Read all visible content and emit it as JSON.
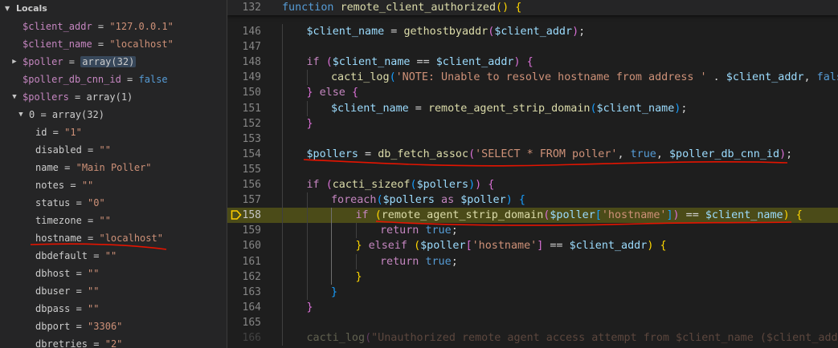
{
  "locals": {
    "header": "Locals",
    "rows": [
      {
        "name": "$client_addr",
        "value": "\"127.0.0.1\"",
        "vtype": "str"
      },
      {
        "name": "$client_name",
        "value": "\"localhost\"",
        "vtype": "str"
      },
      {
        "name": "$poller",
        "value": "array(32)",
        "vtype": "hl"
      },
      {
        "name": "$poller_db_cnn_id",
        "value": "false",
        "vtype": "bool"
      },
      {
        "name": "$pollers",
        "value": "array(1)",
        "vtype": "plain"
      },
      {
        "name": "0",
        "value": "array(32)",
        "vtype": "plain"
      },
      {
        "name": "id",
        "value": "\"1\"",
        "vtype": "str"
      },
      {
        "name": "disabled",
        "value": "\"\"",
        "vtype": "str"
      },
      {
        "name": "name",
        "value": "\"Main Poller\"",
        "vtype": "str"
      },
      {
        "name": "notes",
        "value": "\"\"",
        "vtype": "str"
      },
      {
        "name": "status",
        "value": "\"0\"",
        "vtype": "str"
      },
      {
        "name": "timezone",
        "value": "\"\"",
        "vtype": "str"
      },
      {
        "name": "hostname",
        "value": "\"localhost\"",
        "vtype": "str"
      },
      {
        "name": "dbdefault",
        "value": "\"\"",
        "vtype": "str"
      },
      {
        "name": "dbhost",
        "value": "\"\"",
        "vtype": "str"
      },
      {
        "name": "dbuser",
        "value": "\"\"",
        "vtype": "str"
      },
      {
        "name": "dbpass",
        "value": "\"\"",
        "vtype": "str"
      },
      {
        "name": "dbport",
        "value": "\"3306\"",
        "vtype": "str"
      },
      {
        "name": "dbretries",
        "value": "\"2\"",
        "vtype": "str"
      }
    ]
  },
  "editor": {
    "sticky_line": {
      "num": "132",
      "tokens": [
        [
          "kwb",
          "function "
        ],
        [
          "fn",
          "remote_client_authorized"
        ],
        [
          "brk1",
          "()"
        ],
        [
          "pun",
          " "
        ],
        [
          "brk1",
          "{"
        ]
      ]
    },
    "lines": [
      {
        "num": "146",
        "tokens": [
          [
            "var",
            "$client_name"
          ],
          [
            "pun",
            " = "
          ],
          [
            "fn",
            "gethostbyaddr"
          ],
          [
            "brk2",
            "("
          ],
          [
            "var",
            "$client_addr"
          ],
          [
            "brk2",
            ")"
          ],
          [
            "pun",
            ";"
          ]
        ]
      },
      {
        "num": "147",
        "tokens": []
      },
      {
        "num": "148",
        "tokens": [
          [
            "kw",
            "if "
          ],
          [
            "brk2",
            "("
          ],
          [
            "var",
            "$client_name"
          ],
          [
            "pun",
            " == "
          ],
          [
            "var",
            "$client_addr"
          ],
          [
            "brk2",
            ")"
          ],
          [
            "pun",
            " "
          ],
          [
            "brk2",
            "{"
          ]
        ]
      },
      {
        "num": "149",
        "tokens": [
          [
            "fn",
            "cacti_log"
          ],
          [
            "brk3",
            "("
          ],
          [
            "str",
            "'NOTE: Unable to resolve hostname from address '"
          ],
          [
            "pun",
            " . "
          ],
          [
            "var",
            "$client_addr"
          ],
          [
            "pun",
            ", "
          ],
          [
            "kwb",
            "false"
          ],
          [
            "pun",
            ","
          ]
        ]
      },
      {
        "num": "150",
        "tokens": [
          [
            "brk2",
            "}"
          ],
          [
            "pun",
            " "
          ],
          [
            "kw",
            "else"
          ],
          [
            "pun",
            " "
          ],
          [
            "brk2",
            "{"
          ]
        ]
      },
      {
        "num": "151",
        "tokens": [
          [
            "var",
            "$client_name"
          ],
          [
            "pun",
            " = "
          ],
          [
            "fn",
            "remote_agent_strip_domain"
          ],
          [
            "brk3",
            "("
          ],
          [
            "var",
            "$client_name"
          ],
          [
            "brk3",
            ")"
          ],
          [
            "pun",
            ";"
          ]
        ]
      },
      {
        "num": "152",
        "tokens": [
          [
            "brk2",
            "}"
          ]
        ]
      },
      {
        "num": "153",
        "tokens": []
      },
      {
        "num": "154",
        "tokens": [
          [
            "var",
            "$pollers"
          ],
          [
            "pun",
            " = "
          ],
          [
            "fn",
            "db_fetch_assoc"
          ],
          [
            "brk2",
            "("
          ],
          [
            "str",
            "'SELECT * FROM poller'"
          ],
          [
            "pun",
            ", "
          ],
          [
            "kwb",
            "true"
          ],
          [
            "pun",
            ", "
          ],
          [
            "var",
            "$poller_db_cnn_id"
          ],
          [
            "brk2",
            ")"
          ],
          [
            "pun",
            ";"
          ]
        ]
      },
      {
        "num": "155",
        "tokens": []
      },
      {
        "num": "156",
        "tokens": [
          [
            "kw",
            "if "
          ],
          [
            "brk2",
            "("
          ],
          [
            "fn",
            "cacti_sizeof"
          ],
          [
            "brk3",
            "("
          ],
          [
            "var",
            "$pollers"
          ],
          [
            "brk3",
            ")"
          ],
          [
            "brk2",
            ")"
          ],
          [
            "pun",
            " "
          ],
          [
            "brk2",
            "{"
          ]
        ]
      },
      {
        "num": "157",
        "tokens": [
          [
            "kw",
            "foreach"
          ],
          [
            "brk3",
            "("
          ],
          [
            "var",
            "$pollers"
          ],
          [
            "kw",
            " as "
          ],
          [
            "var",
            "$poller"
          ],
          [
            "brk3",
            ")"
          ],
          [
            "pun",
            " "
          ],
          [
            "brk3",
            "{"
          ]
        ]
      },
      {
        "num": "158",
        "tokens": [
          [
            "kw",
            "if "
          ],
          [
            "brk1",
            "("
          ],
          [
            "fn",
            "remote_agent_strip_domain"
          ],
          [
            "brk2",
            "("
          ],
          [
            "var",
            "$poller"
          ],
          [
            "brk3",
            "["
          ],
          [
            "str",
            "'hostname'"
          ],
          [
            "brk3",
            "]"
          ],
          [
            "brk2",
            ")"
          ],
          [
            "pun",
            " == "
          ],
          [
            "var",
            "$client_name"
          ],
          [
            "brk1",
            ")"
          ],
          [
            "pun",
            " "
          ],
          [
            "brk1",
            "{"
          ]
        ]
      },
      {
        "num": "159",
        "tokens": [
          [
            "kw",
            "return "
          ],
          [
            "kwb",
            "true"
          ],
          [
            "pun",
            ";"
          ]
        ]
      },
      {
        "num": "160",
        "tokens": [
          [
            "brk1",
            "}"
          ],
          [
            "pun",
            " "
          ],
          [
            "kw",
            "elseif"
          ],
          [
            "pun",
            " "
          ],
          [
            "brk1",
            "("
          ],
          [
            "var",
            "$poller"
          ],
          [
            "brk2",
            "["
          ],
          [
            "str",
            "'hostname'"
          ],
          [
            "brk2",
            "]"
          ],
          [
            "pun",
            " == "
          ],
          [
            "var",
            "$client_addr"
          ],
          [
            "brk1",
            ")"
          ],
          [
            "pun",
            " "
          ],
          [
            "brk1",
            "{"
          ]
        ]
      },
      {
        "num": "161",
        "tokens": [
          [
            "kw",
            "return "
          ],
          [
            "kwb",
            "true"
          ],
          [
            "pun",
            ";"
          ]
        ]
      },
      {
        "num": "162",
        "tokens": [
          [
            "brk1",
            "}"
          ]
        ]
      },
      {
        "num": "163",
        "tokens": [
          [
            "brk3",
            "}"
          ]
        ]
      },
      {
        "num": "164",
        "tokens": [
          [
            "brk2",
            "}"
          ]
        ]
      },
      {
        "num": "165",
        "tokens": []
      },
      {
        "num": "166",
        "tokens": [
          [
            "fn",
            "cacti_log"
          ],
          [
            "brk2",
            "("
          ],
          [
            "str",
            "\"Unauthorized remote agent access attempt from $client_name ($client_addr)\""
          ],
          [
            "brk2",
            ")"
          ]
        ]
      }
    ],
    "breakpoint_line": "158",
    "highlight_line": "158"
  },
  "colors": {
    "background": "#1e1e1e",
    "sidebar_bg": "#252526",
    "current_line_bg": "#4b4b18",
    "breakpoint_arrow": "#ffcc00",
    "annotation_red": "#e51400"
  }
}
